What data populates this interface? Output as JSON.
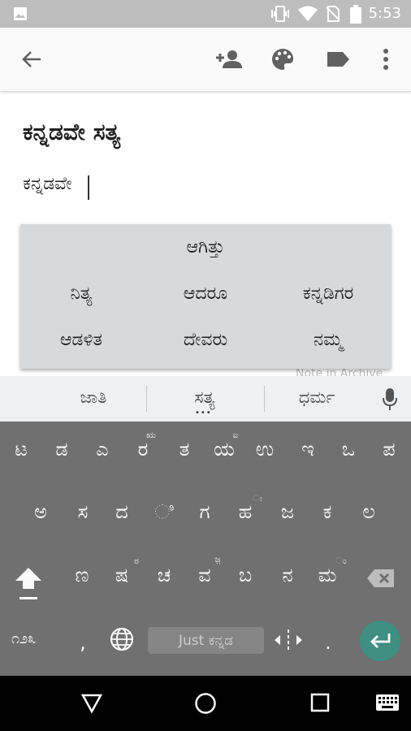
{
  "status_bar": {
    "time": "5:53",
    "icons": [
      "gallery-icon",
      "vibrate-icon",
      "wifi-icon",
      "no-sim-icon",
      "battery-icon"
    ]
  },
  "app_bar": {
    "icons": [
      "back-arrow-icon",
      "add-collaborator-icon",
      "palette-icon",
      "label-icon",
      "more-vert-icon"
    ]
  },
  "note": {
    "title": "ಕನ್ನಡವೇ ಸತ್ಯ",
    "body": "ಕನ್ನಡವೇ",
    "footer_text": "Note in Archive"
  },
  "popup": {
    "rows": [
      [
        "ಆಗಿತ್ತು"
      ],
      [
        "ನಿತ್ಯ",
        "ಆದರೂ",
        "ಕನ್ನಡಿಗರ"
      ],
      [
        "ಆಡಳಿತ",
        "ದೇವರು",
        "ನಮ್ಮ"
      ]
    ]
  },
  "suggestion_strip": {
    "words": [
      "ಜಾತಿ",
      "ಸತ್ಯ",
      "ಧರ್ಮ"
    ],
    "more_indicator": "•••"
  },
  "keyboard": {
    "row1": [
      "ಟ",
      "ಡ",
      "ಎ",
      "ರ",
      "ತ",
      "ಯ",
      "ಉ",
      "ಇ",
      "ಒ",
      "ಪ"
    ],
    "row1_hints": {
      "r": "ಋ",
      "ya": "ಐ"
    },
    "row2": [
      "ಅ",
      "ಸ",
      "ದ",
      "ಿ",
      "ಗ",
      "ಹ",
      "ಜ",
      "ಕ",
      "ಲ"
    ],
    "row2_hints": {
      "ha": "ಃ"
    },
    "row3": [
      "ಣ",
      "ಷ",
      "ಚ",
      "ವ",
      "ಬ",
      "ನ",
      "ಮ"
    ],
    "row3_hints": {
      "sha": "ಠ",
      "va": "ಜ಼",
      "ma": "ಂ"
    },
    "symbols_label": "೧೨೩",
    "comma": ",",
    "period": ".",
    "space_label": "Just ಕನ್ನಡ"
  },
  "colors": {
    "accent": "#3f8f82",
    "keyboard_bg": "#707070",
    "strip_bg": "#eef0f1",
    "popup_bg": "#d7dadd"
  }
}
